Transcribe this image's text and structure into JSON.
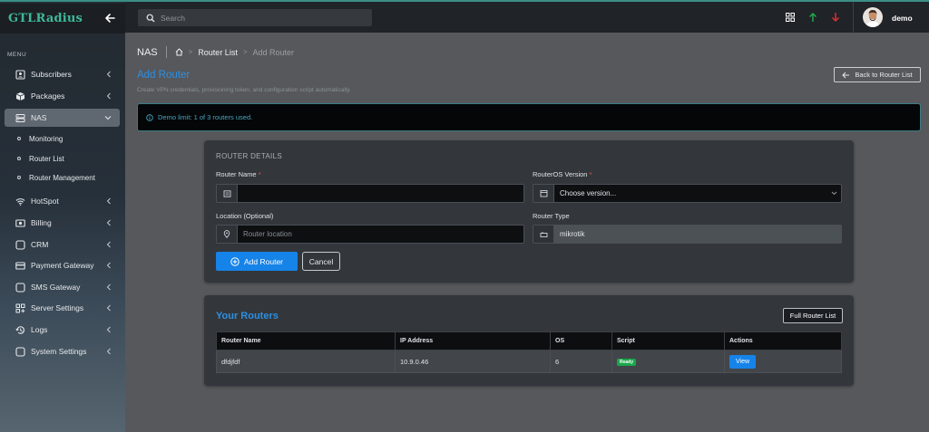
{
  "brand": {
    "name": "GTLRadius"
  },
  "sidebar": {
    "menu_label": "MENU",
    "items": [
      {
        "label": "Subscribers",
        "icon": "address-book-icon"
      },
      {
        "label": "Packages",
        "icon": "box-icon"
      },
      {
        "label": "NAS",
        "icon": "server-icon",
        "active": true,
        "expanded": true
      },
      {
        "label": "HotSpot",
        "icon": "wifi-icon"
      },
      {
        "label": "Billing",
        "icon": "money-icon"
      },
      {
        "label": "CRM",
        "icon": "square-icon"
      },
      {
        "label": "Payment Gateway",
        "icon": "credit-card-icon"
      },
      {
        "label": "SMS Gateway",
        "icon": "square-icon"
      },
      {
        "label": "Server Settings",
        "icon": "grid-plus-icon"
      },
      {
        "label": "Logs",
        "icon": "history-icon"
      },
      {
        "label": "System Settings",
        "icon": "square-icon"
      }
    ],
    "nas_subitems": [
      {
        "label": "Monitoring"
      },
      {
        "label": "Router List"
      },
      {
        "label": "Router Management"
      }
    ]
  },
  "topbar": {
    "search_placeholder": "Search",
    "username": "demo",
    "icons": [
      "grid-icon",
      "arrow-up-icon",
      "arrow-down-icon"
    ],
    "colors": {
      "up": "#1fa84a",
      "down": "#d83232"
    }
  },
  "breadcrumb": {
    "section": "NAS",
    "home_icon": "home-icon",
    "router_list": "Router List",
    "current": "Add Router"
  },
  "page": {
    "title": "Add Router",
    "subtitle": "Create VPN credentials, provisioning token, and configuration script automatically.",
    "back_button": "Back to Router List",
    "alert": "Demo limit: 1 of 3 routers used."
  },
  "form": {
    "heading": "ROUTER DETAILS",
    "router_name_label": "Router Name",
    "router_name_value": "",
    "routeros_label": "RouterOS Version",
    "routeros_value": "Choose version...",
    "location_label": "Location (Optional)",
    "location_placeholder": "Router location",
    "router_type_label": "Router Type",
    "router_type_value": "mikrotik",
    "required_mark": "*",
    "add_button": "Add Router",
    "cancel_button": "Cancel"
  },
  "routers": {
    "title": "Your Routers",
    "full_list_button": "Full Router List",
    "columns": [
      "Router Name",
      "IP Address",
      "OS",
      "Script",
      "Actions"
    ],
    "rows": [
      {
        "name": "dfdjfdf",
        "ip": "10.9.0.46",
        "os": "6",
        "script": "Ready",
        "action": "View"
      }
    ]
  },
  "colors": {
    "accent": "#1683e8",
    "title": "#2d8fe3",
    "brand": "#3fb89a",
    "badge": "#1aa74b",
    "required": "#e0524f"
  }
}
